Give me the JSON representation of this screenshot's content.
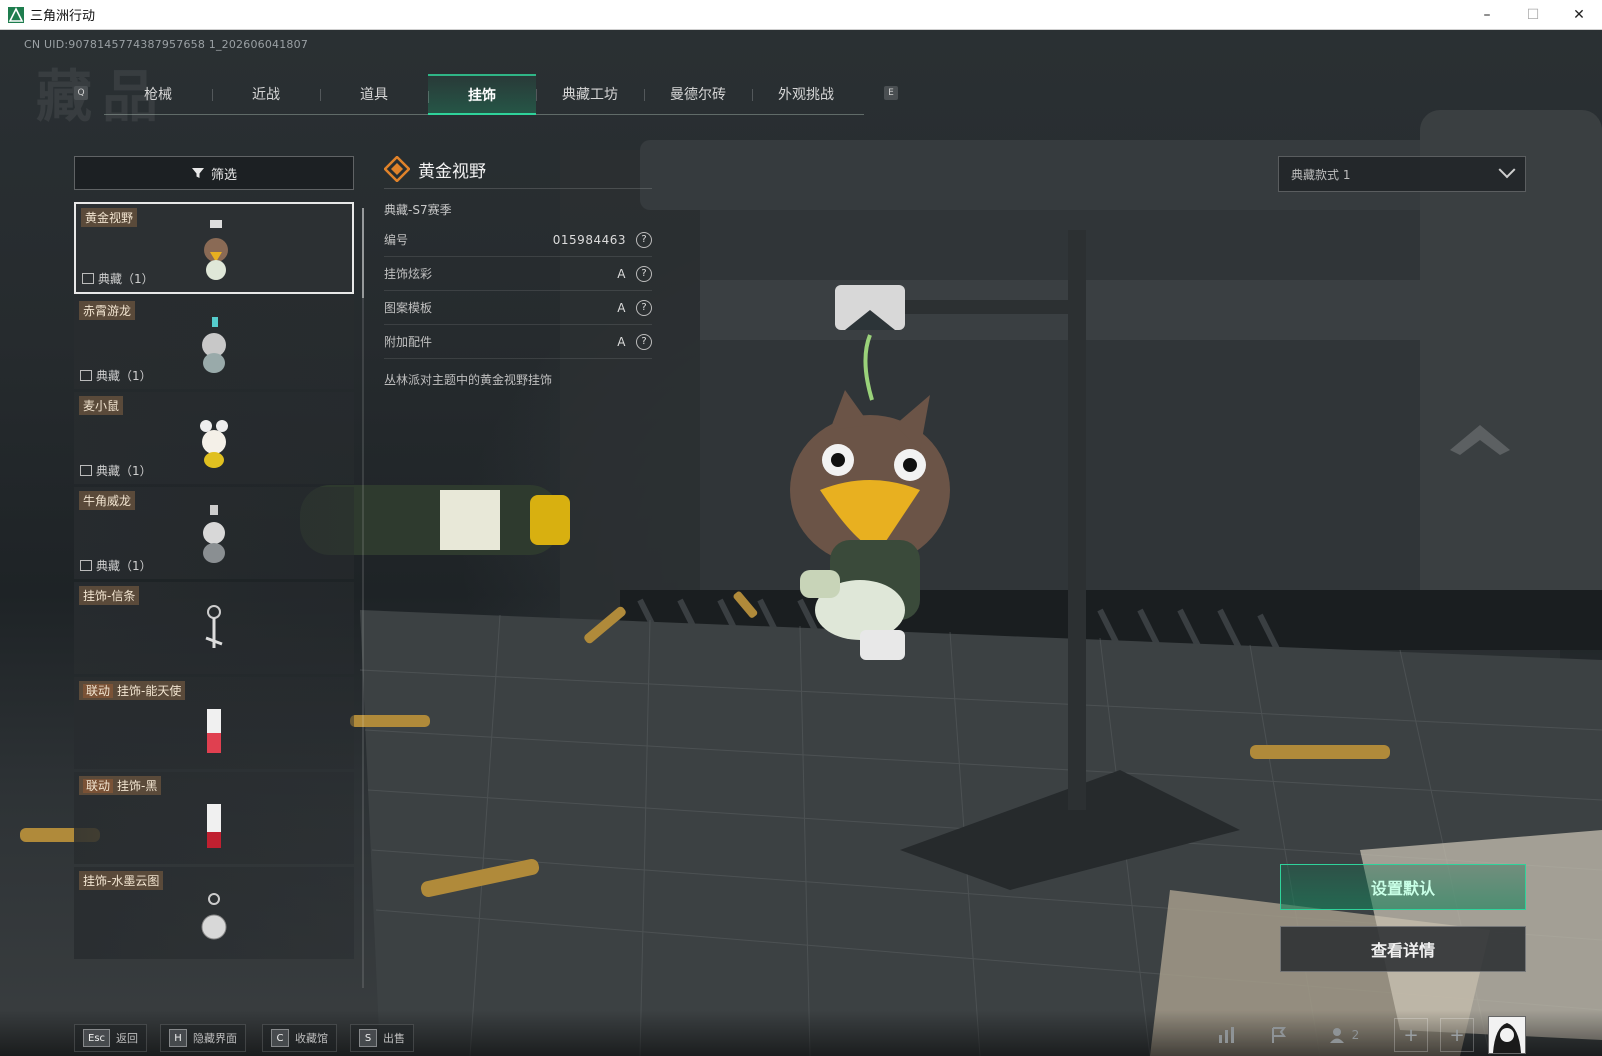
{
  "window": {
    "title": "三角洲行动",
    "minimize": "–",
    "maximize": "☐",
    "close": "✕"
  },
  "uid": "CN UID:9078145774387957658 1_202606041807",
  "page_title": "藏品",
  "tabs": [
    {
      "label": "枪械"
    },
    {
      "label": "近战"
    },
    {
      "label": "道具"
    },
    {
      "label": "挂饰"
    },
    {
      "label": "典藏工坊"
    },
    {
      "label": "曼德尔砖"
    },
    {
      "label": "外观挑战"
    }
  ],
  "tab_keys": {
    "left": "Q",
    "right": "E"
  },
  "filter": {
    "label": "筛选"
  },
  "items": [
    {
      "name": "黄金视野",
      "collab": "",
      "tag": "典藏（1）"
    },
    {
      "name": "赤霄游龙",
      "collab": "",
      "tag": "典藏（1）"
    },
    {
      "name": "麦小鼠",
      "collab": "",
      "tag": "典藏（1）"
    },
    {
      "name": "牛角威龙",
      "collab": "",
      "tag": "典藏（1）"
    },
    {
      "name": "挂饰-信条",
      "collab": "",
      "tag": ""
    },
    {
      "name": "挂饰-能天使",
      "collab": "联动",
      "tag": ""
    },
    {
      "name": "挂饰-黑",
      "collab": "联动",
      "tag": ""
    },
    {
      "name": "挂饰-水墨云图",
      "collab": "",
      "tag": ""
    }
  ],
  "detail": {
    "name": "黄金视野",
    "season": "典藏-S7赛季",
    "rows": [
      {
        "label": "编号",
        "value": "015984463"
      },
      {
        "label": "挂饰炫彩",
        "value": "A"
      },
      {
        "label": "图案模板",
        "value": "A"
      },
      {
        "label": "附加配件",
        "value": "A"
      }
    ],
    "help_icon": "?",
    "description": "丛林派对主题中的黄金视野挂饰"
  },
  "style_select": {
    "value": "典藏款式 1"
  },
  "actions": {
    "set_default": "设置默认",
    "view_details": "查看详情"
  },
  "hints": [
    {
      "key": "Esc",
      "label": "返回"
    },
    {
      "key": "H",
      "label": "隐藏界面"
    },
    {
      "key": "C",
      "label": "收藏馆"
    },
    {
      "key": "S",
      "label": "出售"
    }
  ],
  "status": {
    "friends_count": "2",
    "slot_plus": "+"
  },
  "colors": {
    "accent": "#2fd39b",
    "tag_bg": "#5a4a3a",
    "collab_bg": "#7a5236"
  }
}
